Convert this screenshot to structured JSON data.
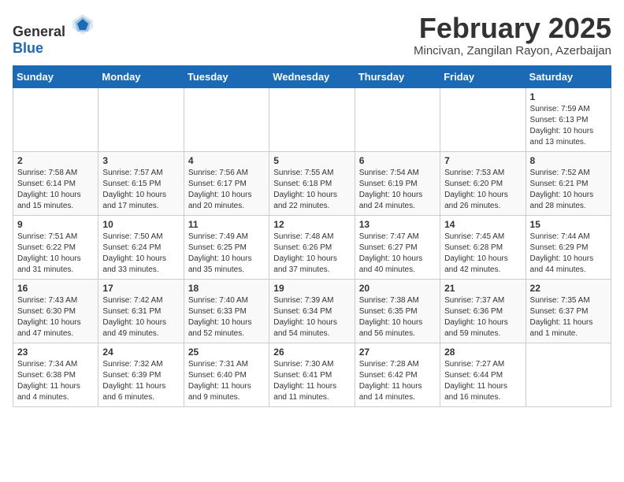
{
  "header": {
    "logo_general": "General",
    "logo_blue": "Blue",
    "month_title": "February 2025",
    "location": "Mincivan, Zangilan Rayon, Azerbaijan"
  },
  "days_of_week": [
    "Sunday",
    "Monday",
    "Tuesday",
    "Wednesday",
    "Thursday",
    "Friday",
    "Saturday"
  ],
  "weeks": [
    [
      {
        "day": "",
        "content": ""
      },
      {
        "day": "",
        "content": ""
      },
      {
        "day": "",
        "content": ""
      },
      {
        "day": "",
        "content": ""
      },
      {
        "day": "",
        "content": ""
      },
      {
        "day": "",
        "content": ""
      },
      {
        "day": "1",
        "content": "Sunrise: 7:59 AM\nSunset: 6:13 PM\nDaylight: 10 hours and 13 minutes."
      }
    ],
    [
      {
        "day": "2",
        "content": "Sunrise: 7:58 AM\nSunset: 6:14 PM\nDaylight: 10 hours and 15 minutes."
      },
      {
        "day": "3",
        "content": "Sunrise: 7:57 AM\nSunset: 6:15 PM\nDaylight: 10 hours and 17 minutes."
      },
      {
        "day": "4",
        "content": "Sunrise: 7:56 AM\nSunset: 6:17 PM\nDaylight: 10 hours and 20 minutes."
      },
      {
        "day": "5",
        "content": "Sunrise: 7:55 AM\nSunset: 6:18 PM\nDaylight: 10 hours and 22 minutes."
      },
      {
        "day": "6",
        "content": "Sunrise: 7:54 AM\nSunset: 6:19 PM\nDaylight: 10 hours and 24 minutes."
      },
      {
        "day": "7",
        "content": "Sunrise: 7:53 AM\nSunset: 6:20 PM\nDaylight: 10 hours and 26 minutes."
      },
      {
        "day": "8",
        "content": "Sunrise: 7:52 AM\nSunset: 6:21 PM\nDaylight: 10 hours and 28 minutes."
      }
    ],
    [
      {
        "day": "9",
        "content": "Sunrise: 7:51 AM\nSunset: 6:22 PM\nDaylight: 10 hours and 31 minutes."
      },
      {
        "day": "10",
        "content": "Sunrise: 7:50 AM\nSunset: 6:24 PM\nDaylight: 10 hours and 33 minutes."
      },
      {
        "day": "11",
        "content": "Sunrise: 7:49 AM\nSunset: 6:25 PM\nDaylight: 10 hours and 35 minutes."
      },
      {
        "day": "12",
        "content": "Sunrise: 7:48 AM\nSunset: 6:26 PM\nDaylight: 10 hours and 37 minutes."
      },
      {
        "day": "13",
        "content": "Sunrise: 7:47 AM\nSunset: 6:27 PM\nDaylight: 10 hours and 40 minutes."
      },
      {
        "day": "14",
        "content": "Sunrise: 7:45 AM\nSunset: 6:28 PM\nDaylight: 10 hours and 42 minutes."
      },
      {
        "day": "15",
        "content": "Sunrise: 7:44 AM\nSunset: 6:29 PM\nDaylight: 10 hours and 44 minutes."
      }
    ],
    [
      {
        "day": "16",
        "content": "Sunrise: 7:43 AM\nSunset: 6:30 PM\nDaylight: 10 hours and 47 minutes."
      },
      {
        "day": "17",
        "content": "Sunrise: 7:42 AM\nSunset: 6:31 PM\nDaylight: 10 hours and 49 minutes."
      },
      {
        "day": "18",
        "content": "Sunrise: 7:40 AM\nSunset: 6:33 PM\nDaylight: 10 hours and 52 minutes."
      },
      {
        "day": "19",
        "content": "Sunrise: 7:39 AM\nSunset: 6:34 PM\nDaylight: 10 hours and 54 minutes."
      },
      {
        "day": "20",
        "content": "Sunrise: 7:38 AM\nSunset: 6:35 PM\nDaylight: 10 hours and 56 minutes."
      },
      {
        "day": "21",
        "content": "Sunrise: 7:37 AM\nSunset: 6:36 PM\nDaylight: 10 hours and 59 minutes."
      },
      {
        "day": "22",
        "content": "Sunrise: 7:35 AM\nSunset: 6:37 PM\nDaylight: 11 hours and 1 minute."
      }
    ],
    [
      {
        "day": "23",
        "content": "Sunrise: 7:34 AM\nSunset: 6:38 PM\nDaylight: 11 hours and 4 minutes."
      },
      {
        "day": "24",
        "content": "Sunrise: 7:32 AM\nSunset: 6:39 PM\nDaylight: 11 hours and 6 minutes."
      },
      {
        "day": "25",
        "content": "Sunrise: 7:31 AM\nSunset: 6:40 PM\nDaylight: 11 hours and 9 minutes."
      },
      {
        "day": "26",
        "content": "Sunrise: 7:30 AM\nSunset: 6:41 PM\nDaylight: 11 hours and 11 minutes."
      },
      {
        "day": "27",
        "content": "Sunrise: 7:28 AM\nSunset: 6:42 PM\nDaylight: 11 hours and 14 minutes."
      },
      {
        "day": "28",
        "content": "Sunrise: 7:27 AM\nSunset: 6:44 PM\nDaylight: 11 hours and 16 minutes."
      },
      {
        "day": "",
        "content": ""
      }
    ]
  ]
}
